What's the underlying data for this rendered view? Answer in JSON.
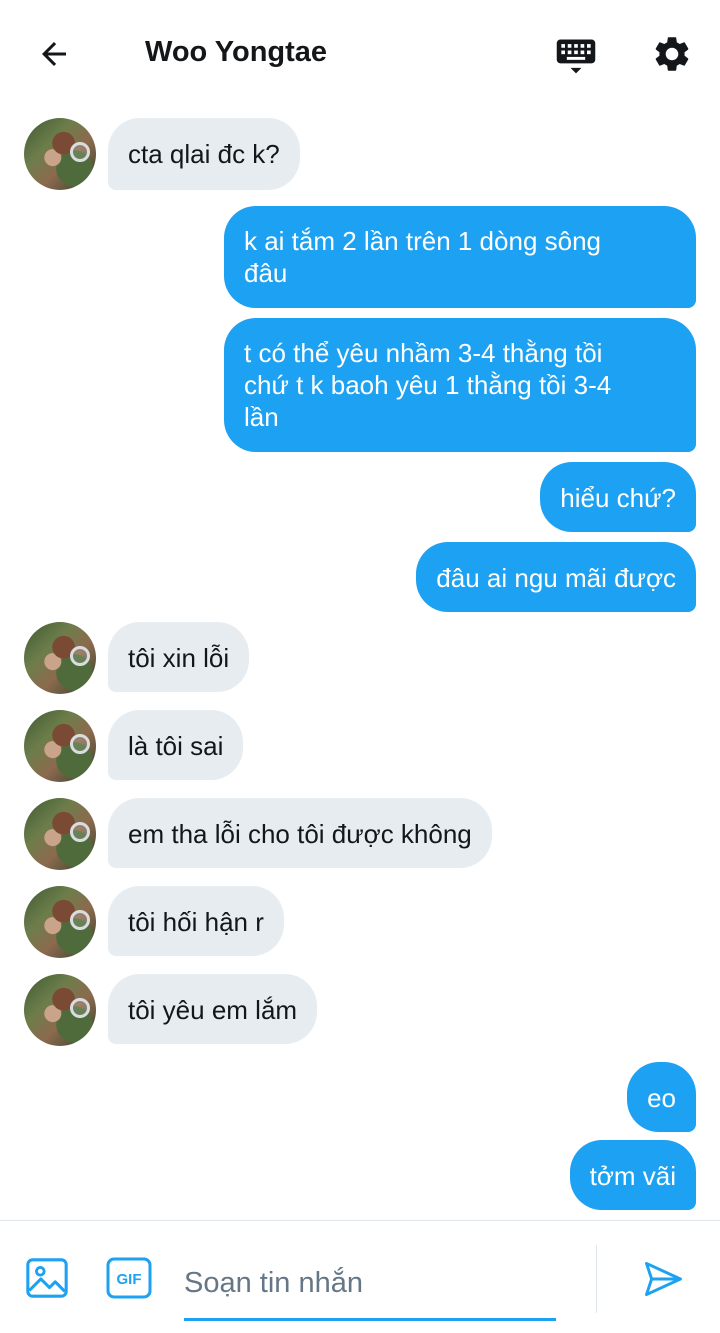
{
  "header": {
    "title": "Woo Yongtae",
    "icons": [
      "back-arrow-icon",
      "keyboard-icon",
      "gear-icon"
    ]
  },
  "messages": [
    {
      "side": "in",
      "text": "cta qlai đc k?"
    },
    {
      "side": "out",
      "line1": "k ai tắm 2 lần trên 1 dòng sông",
      "line2": "đâu"
    },
    {
      "side": "out",
      "line1": "t có thể yêu nhầm 3-4 thằng tồi",
      "line2": "chứ t k baoh yêu 1 thằng tồi 3-4",
      "line3": "lần"
    },
    {
      "side": "out",
      "text": "hiểu chứ?"
    },
    {
      "side": "out",
      "text": "đâu ai ngu mãi được"
    },
    {
      "side": "in",
      "text": "tôi xin lỗi"
    },
    {
      "side": "in",
      "text": "là tôi sai"
    },
    {
      "side": "in",
      "text": "em tha lỗi cho tôi được không"
    },
    {
      "side": "in",
      "text": "tôi hối hận r"
    },
    {
      "side": "in",
      "text": "tôi yêu em lắm"
    },
    {
      "side": "out",
      "text": "eo"
    },
    {
      "side": "out",
      "text": "tởm vãi"
    }
  ],
  "composer": {
    "placeholder": "Soạn tin nhắn",
    "value": "",
    "gif_label": "GIF",
    "icons": [
      "image-icon",
      "gif-icon",
      "send-icon"
    ]
  },
  "colors": {
    "accent": "#1da1f2",
    "incoming_bubble": "#e6ecf0",
    "placeholder": "#657786"
  }
}
